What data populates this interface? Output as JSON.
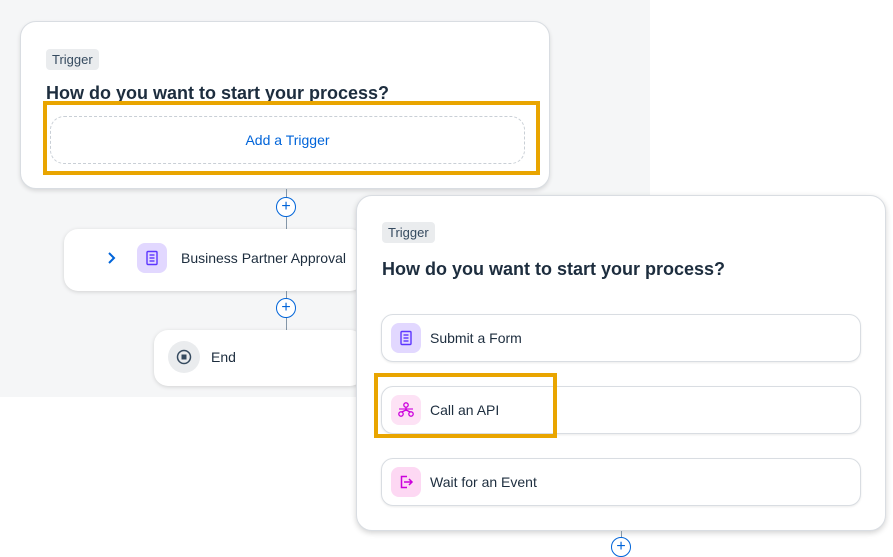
{
  "left_panel": {
    "trigger_tag": "Trigger",
    "question": "How do you want to start your process?",
    "add_trigger_label": "Add a Trigger",
    "plus_symbol": "+",
    "steps": [
      {
        "label": "Business Partner Approval",
        "icon": "form-icon",
        "expand_icon": "chevron-right-icon"
      },
      {
        "label": "End",
        "icon": "stop-icon"
      }
    ]
  },
  "trigger_popup": {
    "trigger_tag": "Trigger",
    "question": "How do you want to start your process?",
    "options": [
      {
        "label": "Submit a Form",
        "icon": "form-icon"
      },
      {
        "label": "Call an API",
        "icon": "api-icon"
      },
      {
        "label": "Wait for an Event",
        "icon": "event-icon"
      }
    ]
  },
  "colors": {
    "highlight": "#e9a500",
    "link": "#0064d9",
    "form_icon_bg": "#e2d8ff",
    "api_icon_bg": "#fde2f5",
    "event_icon_bg": "#fdd8f3"
  }
}
